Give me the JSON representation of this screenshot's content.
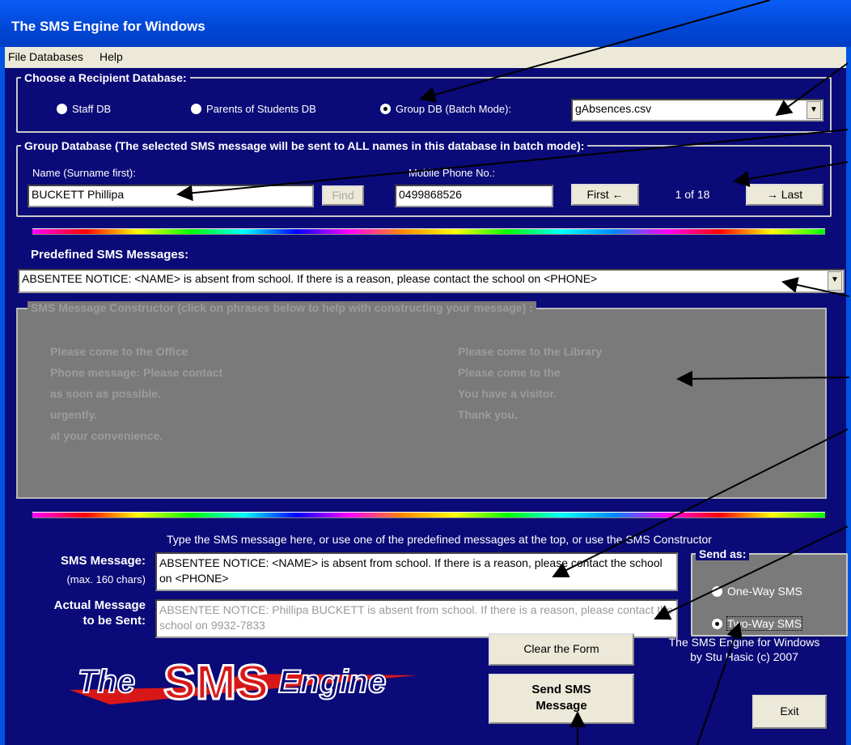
{
  "window": {
    "title": "The SMS Engine for Windows"
  },
  "menu": {
    "items": [
      "File",
      "Databases",
      "Help"
    ]
  },
  "recipient_db": {
    "legend": "Choose a Recipient Database:",
    "options": [
      "Staff DB",
      "Parents of Students DB",
      "Group DB (Batch Mode):"
    ],
    "selected": "Group DB (Batch Mode):",
    "file_value": "gAbsences.csv"
  },
  "group_db": {
    "legend": "Group Database (The selected SMS message will be sent to ALL names in this database in batch mode):",
    "name_label": "Name (Surname first):",
    "name_value": "BUCKETT Phillipa",
    "find_label": "Find",
    "phone_label": "Mobile Phone No.:",
    "phone_value": "0499868526",
    "first_label": "First",
    "record": "1 of 18",
    "last_label": "Last"
  },
  "predefined": {
    "label": "Predefined SMS Messages:",
    "value": "ABSENTEE NOTICE: <NAME> is absent from school. If there is a reason, please contact the school on <PHONE>"
  },
  "constructor": {
    "legend": "SMS Message Constructor (click on phrases below to help with constructing your message) :",
    "left_phrases": [
      "Please come to the Office",
      "Phone message: Please contact",
      "as soon as possible.",
      "urgently.",
      "at your convenience."
    ],
    "right_phrases": [
      "Please come to the Library",
      "Please come to the",
      "You have a visitor.",
      "Thank you."
    ]
  },
  "compose": {
    "hint": "Type the SMS message here, or use one of the predefined messages at the top, or use the SMS Constructor",
    "sms_label": "SMS Message:",
    "sms_sublabel": "(max. 160 chars)",
    "sms_value": "ABSENTEE NOTICE: <NAME> is absent from school. If there is a reason, please contact the school on <PHONE>",
    "actual_label_1": "Actual Message",
    "actual_label_2": "to be Sent:",
    "actual_value": "ABSENTEE NOTICE: Phillipa BUCKETT is absent from school. If there is a reason, please contact the school on 9932-7833"
  },
  "send_as": {
    "legend": "Send as:",
    "options": [
      "One-Way SMS",
      "Two-Way SMS"
    ],
    "selected": "Two-Way SMS"
  },
  "actions": {
    "clear_label": "Clear the Form",
    "send_label_1": "Send SMS",
    "send_label_2": "Message",
    "exit_label": "Exit"
  },
  "credits": {
    "line1": "The SMS Engine for Windows",
    "line2": "by Stu Hasic (c) 2007"
  },
  "logo": {
    "text_left": "The",
    "text_mid": "SMS",
    "text_right": "Engine"
  }
}
